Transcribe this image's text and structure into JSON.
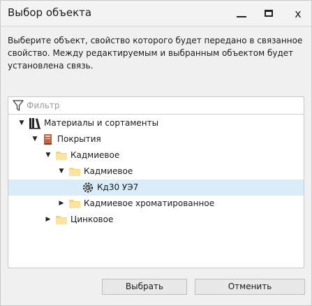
{
  "window": {
    "title": "Выбор объекта",
    "controls": {
      "minimize": "minimize-icon",
      "maximize": "maximize-icon",
      "close": "x"
    }
  },
  "description": "Выберите объект, свойство которого будет передано в связанное свойство. Между редактируемым и выбранным объектом будет установлена связь.",
  "filter": {
    "placeholder": "Фильтр",
    "value": "",
    "icon": "filter-icon"
  },
  "tree": [
    {
      "label": "Материалы и сортаменты",
      "level": 0,
      "expander": "expanded",
      "icon": "library-icon",
      "selected": false
    },
    {
      "label": "Покрытия",
      "level": 1,
      "expander": "expanded",
      "icon": "book-icon",
      "selected": false
    },
    {
      "label": "Кадмиевое",
      "level": 2,
      "expander": "expanded",
      "icon": "folder-icon",
      "selected": false
    },
    {
      "label": "Кадмиевое",
      "level": 3,
      "expander": "expanded",
      "icon": "folder-icon",
      "selected": false
    },
    {
      "label": "Кд30 УЭ7",
      "level": 4,
      "expander": "none",
      "icon": "material-gear-icon",
      "selected": true
    },
    {
      "label": "Кадмиевое хроматированное",
      "level": 3,
      "expander": "collapsed",
      "icon": "folder-icon",
      "selected": false
    },
    {
      "label": "Цинковое",
      "level": 2,
      "expander": "collapsed",
      "icon": "folder-icon",
      "selected": false
    }
  ],
  "buttons": {
    "select": "Выбрать",
    "cancel": "Отменить"
  },
  "colors": {
    "selection": "#d9ecf7",
    "folder": "#f6d67a",
    "book": "#c9623f"
  }
}
